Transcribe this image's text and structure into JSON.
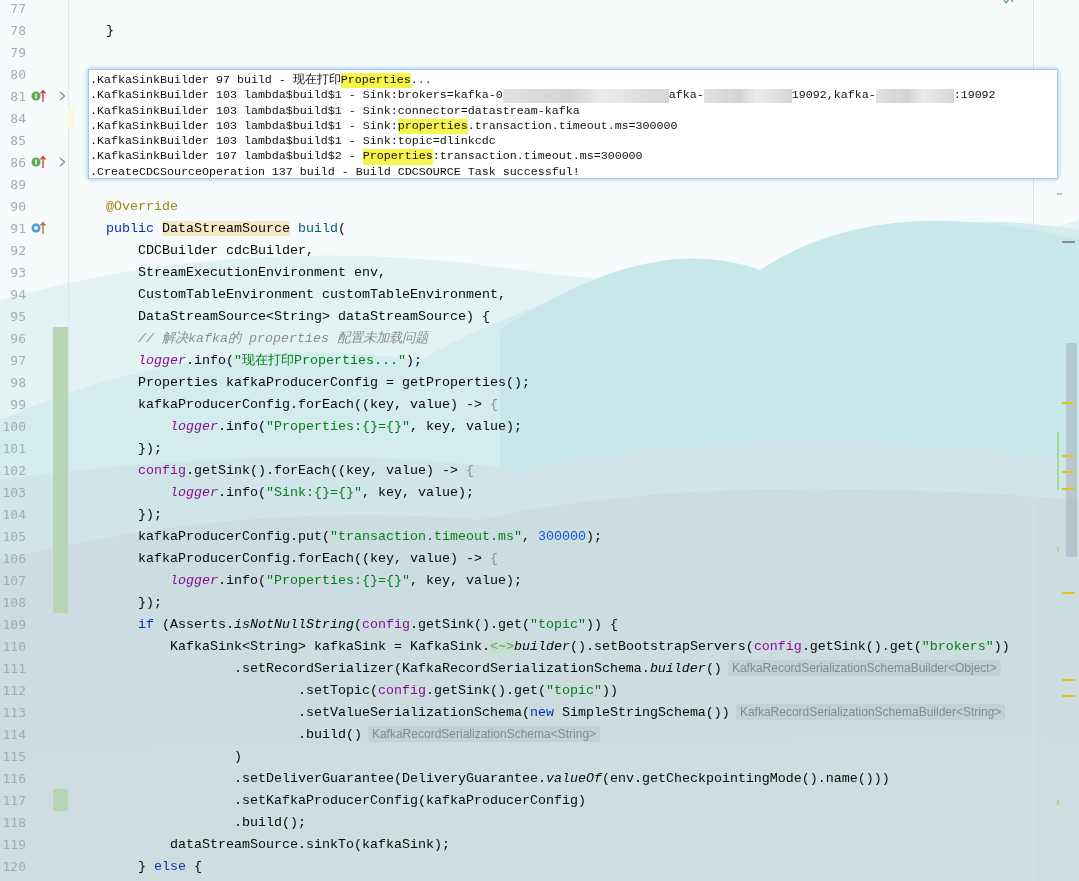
{
  "editor": {
    "lines": [
      {
        "number": "77",
        "changed": false
      },
      {
        "number": "78",
        "changed": false,
        "segments": [
          {
            "kind": "code",
            "tokens": [
              {
                "text": "    }",
                "kind": "plain"
              }
            ]
          }
        ]
      },
      {
        "number": "79",
        "changed": false
      },
      {
        "number": "80",
        "changed": false
      },
      {
        "number": "81",
        "changed": false,
        "marker": {
          "kind": "implemented"
        },
        "foldable": true
      },
      {
        "number": "84",
        "changed": false,
        "current": true
      },
      {
        "number": "85",
        "changed": false
      },
      {
        "number": "86",
        "changed": false,
        "marker": {
          "kind": "implemented"
        },
        "foldable": true
      },
      {
        "number": "89",
        "changed": false
      },
      {
        "number": "90",
        "changed": false,
        "segments": [
          {
            "kind": "code",
            "tokens": [
              {
                "text": "    @Override",
                "kind": "annotation"
              }
            ]
          }
        ]
      },
      {
        "number": "91",
        "changed": false,
        "marker": {
          "kind": "overrides"
        },
        "segments": [
          {
            "kind": "code",
            "tokens": [
              {
                "text": "    public",
                "kind": "keyword"
              },
              {
                "text": " DataStreamSource",
                "kind": "highlight"
              },
              {
                "text": " build",
                "kind": "method"
              },
              {
                "text": "(",
                "kind": "plain"
              }
            ]
          }
        ]
      },
      {
        "number": "92",
        "changed": false,
        "segments": [
          {
            "kind": "code",
            "tokens": [
              {
                "text": "        CDCBuilder cdcBuilder,",
                "kind": "plain"
              }
            ]
          }
        ]
      },
      {
        "number": "93",
        "changed": false,
        "segments": [
          {
            "kind": "code",
            "tokens": [
              {
                "text": "        StreamExecutionEnvironment env,",
                "kind": "plain"
              }
            ]
          }
        ]
      },
      {
        "number": "94",
        "changed": false,
        "segments": [
          {
            "kind": "code",
            "tokens": [
              {
                "text": "        CustomTableEnvironment customTableEnvironment,",
                "kind": "plain"
              }
            ]
          }
        ]
      },
      {
        "number": "95",
        "changed": false,
        "segments": [
          {
            "kind": "code",
            "tokens": [
              {
                "text": "        DataStreamSource<String> dataStreamSource) {",
                "kind": "plain"
              }
            ]
          }
        ]
      },
      {
        "number": "96",
        "changed": true,
        "segments": [
          {
            "kind": "code",
            "tokens": [
              {
                "text": "        // 解决kafka的 properties 配置未加载问题",
                "kind": "comment"
              }
            ]
          }
        ]
      },
      {
        "number": "97",
        "changed": true,
        "segments": [
          {
            "kind": "code",
            "tokens": [
              {
                "text": "        logger",
                "kind": "logger"
              },
              {
                "text": ".info(",
                "kind": "plain"
              },
              {
                "text": "\"现在打印Properties...\"",
                "kind": "string"
              },
              {
                "text": ");",
                "kind": "plain"
              }
            ]
          }
        ]
      },
      {
        "number": "98",
        "changed": true,
        "segments": [
          {
            "kind": "code",
            "tokens": [
              {
                "text": "        Properties kafkaProducerConfig = getProperties();",
                "kind": "plain"
              }
            ]
          }
        ]
      },
      {
        "number": "99",
        "changed": true,
        "segments": [
          {
            "kind": "code",
            "tokens": [
              {
                "text": "        kafkaProducerConfig.forEach((key, value) ->",
                "kind": "plain"
              },
              {
                "text": " {",
                "kind": "dim"
              }
            ]
          }
        ]
      },
      {
        "number": "100",
        "changed": true,
        "segments": [
          {
            "kind": "code",
            "tokens": [
              {
                "text": "            logger",
                "kind": "logger"
              },
              {
                "text": ".info(",
                "kind": "plain"
              },
              {
                "text": "\"Properties:{}={}\"",
                "kind": "string"
              },
              {
                "text": ", key, value);",
                "kind": "plain"
              }
            ]
          }
        ]
      },
      {
        "number": "101",
        "changed": true,
        "segments": [
          {
            "kind": "code",
            "tokens": [
              {
                "text": "        });",
                "kind": "plain"
              }
            ]
          }
        ]
      },
      {
        "number": "102",
        "changed": true,
        "segments": [
          {
            "kind": "code",
            "tokens": [
              {
                "text": "        config",
                "kind": "field"
              },
              {
                "text": ".getSink().forEach((key, value) ->",
                "kind": "plain"
              },
              {
                "text": " {",
                "kind": "dim"
              }
            ]
          }
        ]
      },
      {
        "number": "103",
        "changed": true,
        "segments": [
          {
            "kind": "code",
            "tokens": [
              {
                "text": "            logger",
                "kind": "logger"
              },
              {
                "text": ".info(",
                "kind": "plain"
              },
              {
                "text": "\"Sink:{}={}\"",
                "kind": "string"
              },
              {
                "text": ", key, value);",
                "kind": "plain"
              }
            ]
          }
        ]
      },
      {
        "number": "104",
        "changed": true,
        "segments": [
          {
            "kind": "code",
            "tokens": [
              {
                "text": "        });",
                "kind": "plain"
              }
            ]
          }
        ]
      },
      {
        "number": "105",
        "changed": true,
        "segments": [
          {
            "kind": "code",
            "tokens": [
              {
                "text": "        kafkaProducerConfig.put(",
                "kind": "plain"
              },
              {
                "text": "\"transaction.timeout.ms\"",
                "kind": "string"
              },
              {
                "text": ",",
                "kind": "plain"
              },
              {
                "text": " 300000",
                "kind": "number"
              },
              {
                "text": ");",
                "kind": "plain"
              }
            ]
          }
        ]
      },
      {
        "number": "106",
        "changed": true,
        "segments": [
          {
            "kind": "code",
            "tokens": [
              {
                "text": "        kafkaProducerConfig.forEach((key, value) ->",
                "kind": "plain"
              },
              {
                "text": " {",
                "kind": "dim"
              }
            ]
          }
        ]
      },
      {
        "number": "107",
        "changed": true,
        "segments": [
          {
            "kind": "code",
            "tokens": [
              {
                "text": "            logger",
                "kind": "logger"
              },
              {
                "text": ".info(",
                "kind": "plain"
              },
              {
                "text": "\"Properties:{}={}\"",
                "kind": "string"
              },
              {
                "text": ", key, value);",
                "kind": "plain"
              }
            ]
          }
        ]
      },
      {
        "number": "108",
        "changed": true,
        "segments": [
          {
            "kind": "code",
            "tokens": [
              {
                "text": "        });",
                "kind": "plain"
              }
            ]
          }
        ]
      },
      {
        "number": "109",
        "changed": false,
        "segments": [
          {
            "kind": "code",
            "tokens": [
              {
                "text": "        if",
                "kind": "keyword"
              },
              {
                "text": " (Asserts.",
                "kind": "plain"
              },
              {
                "text": "isNotNullString",
                "kind": "italic"
              },
              {
                "text": "(",
                "kind": "plain"
              },
              {
                "text": "config",
                "kind": "field"
              },
              {
                "text": ".getSink().get(",
                "kind": "plain"
              },
              {
                "text": "\"topic\"",
                "kind": "string"
              },
              {
                "text": ")) {",
                "kind": "plain"
              }
            ]
          }
        ]
      },
      {
        "number": "110",
        "changed": false,
        "segments": [
          {
            "kind": "code",
            "tokens": [
              {
                "text": "            KafkaSink<String> kafkaSink = KafkaSink.",
                "kind": "plain"
              }
            ]
          },
          {
            "kind": "fold",
            "text": "<~>"
          },
          {
            "kind": "code",
            "tokens": [
              {
                "text": "builder",
                "kind": "italic"
              },
              {
                "text": "().setBootstrapServers(",
                "kind": "plain"
              },
              {
                "text": "config",
                "kind": "field"
              },
              {
                "text": ".getSink().get(",
                "kind": "plain"
              },
              {
                "text": "\"brokers\"",
                "kind": "string"
              },
              {
                "text": "))",
                "kind": "plain"
              }
            ]
          }
        ]
      },
      {
        "number": "111",
        "changed": false,
        "segments": [
          {
            "kind": "code",
            "tokens": [
              {
                "text": "                    .setRecordSerializer(KafkaRecordSerializationSchema.",
                "kind": "plain"
              },
              {
                "text": "builder",
                "kind": "italic"
              },
              {
                "text": "()",
                "kind": "plain"
              }
            ]
          },
          {
            "kind": "hint",
            "text": "KafkaRecordSerializationSchemaBuilder<Object>"
          }
        ]
      },
      {
        "number": "112",
        "changed": false,
        "segments": [
          {
            "kind": "code",
            "tokens": [
              {
                "text": "                            .setTopic(",
                "kind": "plain"
              },
              {
                "text": "config",
                "kind": "field"
              },
              {
                "text": ".getSink().get(",
                "kind": "plain"
              },
              {
                "text": "\"topic\"",
                "kind": "string"
              },
              {
                "text": "))",
                "kind": "plain"
              }
            ]
          }
        ]
      },
      {
        "number": "113",
        "changed": false,
        "segments": [
          {
            "kind": "code",
            "tokens": [
              {
                "text": "                            .setValueSerializationSchema(",
                "kind": "plain"
              },
              {
                "text": "new",
                "kind": "keyword"
              },
              {
                "text": " SimpleStringSchema())",
                "kind": "plain"
              }
            ]
          },
          {
            "kind": "hint",
            "text": "KafkaRecordSerializationSchemaBuilder<String>"
          }
        ]
      },
      {
        "number": "114",
        "changed": false,
        "segments": [
          {
            "kind": "code",
            "tokens": [
              {
                "text": "                            .build()",
                "kind": "plain"
              }
            ]
          },
          {
            "kind": "hint",
            "text": "KafkaRecordSerializationSchema<String>"
          }
        ]
      },
      {
        "number": "115",
        "changed": false,
        "segments": [
          {
            "kind": "code",
            "tokens": [
              {
                "text": "                    )",
                "kind": "plain"
              }
            ]
          }
        ]
      },
      {
        "number": "116",
        "changed": false,
        "segments": [
          {
            "kind": "code",
            "tokens": [
              {
                "text": "                    .setDeliverGuarantee(DeliveryGuarantee.",
                "kind": "plain"
              },
              {
                "text": "valueOf",
                "kind": "italic"
              },
              {
                "text": "(env.getCheckpointingMode().name()))",
                "kind": "plain"
              }
            ]
          }
        ]
      },
      {
        "number": "117",
        "changed": true,
        "segments": [
          {
            "kind": "code",
            "tokens": [
              {
                "text": "                    .setKafkaProducerConfig(kafkaProducerConfig)",
                "kind": "plain"
              }
            ]
          }
        ]
      },
      {
        "number": "118",
        "changed": false,
        "segments": [
          {
            "kind": "code",
            "tokens": [
              {
                "text": "                    .build();",
                "kind": "plain"
              }
            ]
          }
        ]
      },
      {
        "number": "119",
        "changed": false,
        "segments": [
          {
            "kind": "code",
            "tokens": [
              {
                "text": "            dataStreamSource.sinkTo(kafkaSink);",
                "kind": "plain"
              }
            ]
          }
        ]
      },
      {
        "number": "120",
        "changed": false,
        "segments": [
          {
            "kind": "code",
            "tokens": [
              {
                "text": "        }",
                "kind": "plain"
              },
              {
                "text": " else",
                "kind": "keyword"
              },
              {
                "text": " {",
                "kind": "plain"
              }
            ]
          }
        ]
      }
    ]
  },
  "log_popup": {
    "lines": [
      [
        {
          "text": ".KafkaSinkBuilder 97 build - 现在打印",
          "highlight": false
        },
        {
          "text": "Properties",
          "highlight": true
        },
        {
          "text": "...",
          "highlight": false
        }
      ],
      [
        {
          "text": ".KafkaSinkBuilder 103 lambda$build$1 - Sink:brokers=kafka-0",
          "highlight": false
        },
        {
          "kind": "redacted"
        },
        {
          "text": "afka-",
          "highlight": false
        },
        {
          "kind": "redacted"
        },
        {
          "text": "19092,kafka-",
          "highlight": false
        },
        {
          "kind": "redacted"
        },
        {
          "text": ":19092",
          "highlight": false
        }
      ],
      [
        {
          "text": ".KafkaSinkBuilder 103 lambda$build$1 - Sink:connector=datastream-kafka",
          "highlight": false
        }
      ],
      [
        {
          "text": ".KafkaSinkBuilder 103 lambda$build$1 - Sink:",
          "highlight": false
        },
        {
          "text": "properties",
          "highlight": true
        },
        {
          "text": ".transaction.timeout.ms=300000",
          "highlight": false
        }
      ],
      [
        {
          "text": ".KafkaSinkBuilder 103 lambda$build$1 - Sink:topic=dlinkcdc",
          "highlight": false
        }
      ],
      [
        {
          "text": ".KafkaSinkBuilder 107 lambda$build$2 - ",
          "highlight": false
        },
        {
          "text": "Properties",
          "highlight": true
        },
        {
          "text": ":transaction.timeout.ms=300000",
          "highlight": false
        }
      ],
      [
        {
          "text": ".CreateCDCSourceOperation 137 build - Build CDCSOURCE Task successful!",
          "highlight": false
        }
      ]
    ]
  }
}
